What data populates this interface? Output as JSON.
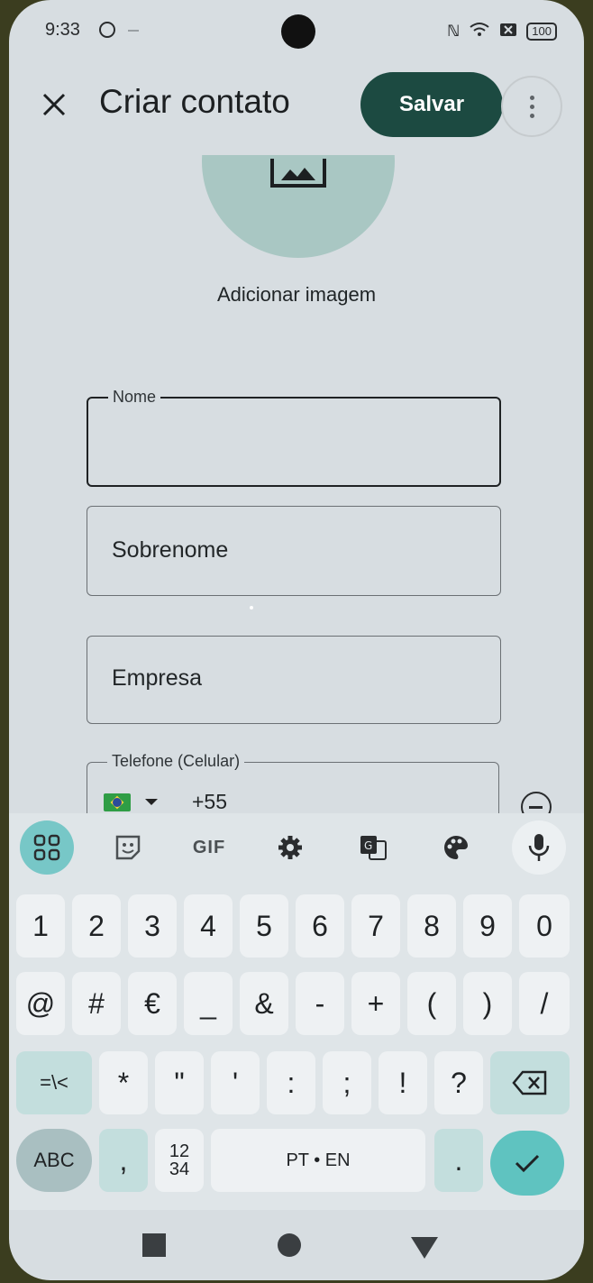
{
  "status_bar": {
    "time": "9:33",
    "battery": "100"
  },
  "top_bar": {
    "title": "Criar contato",
    "save_label": "Salvar"
  },
  "photo": {
    "add_image_label": "Adicionar imagem"
  },
  "form": {
    "first_name": {
      "label": "Nome",
      "value": ""
    },
    "last_name": {
      "placeholder": "Sobrenome"
    },
    "company": {
      "placeholder": "Empresa"
    },
    "phone": {
      "label": "Telefone (Celular)",
      "country_code": "+55",
      "country": "brazil-flag"
    }
  },
  "keyboard": {
    "toolbar": {
      "gif_label": "GIF"
    },
    "row1": [
      "1",
      "2",
      "3",
      "4",
      "5",
      "6",
      "7",
      "8",
      "9",
      "0"
    ],
    "row2": [
      "@",
      "#",
      "€",
      "_",
      "&",
      "-",
      "+",
      "(",
      ")",
      "/"
    ],
    "row3": {
      "switch_label": "=\\<",
      "keys": [
        "*",
        "\"",
        "'",
        ":",
        ";",
        "!",
        "?"
      ]
    },
    "row4": {
      "abc_label": "ABC",
      "comma": ",",
      "numpad_top": "12",
      "numpad_bottom": "34",
      "space_label": "PT • EN",
      "period": "."
    }
  },
  "colors": {
    "accent": "#1c4a41",
    "keyboard_accent": "#5fc3c0",
    "background": "#d7dde1"
  }
}
